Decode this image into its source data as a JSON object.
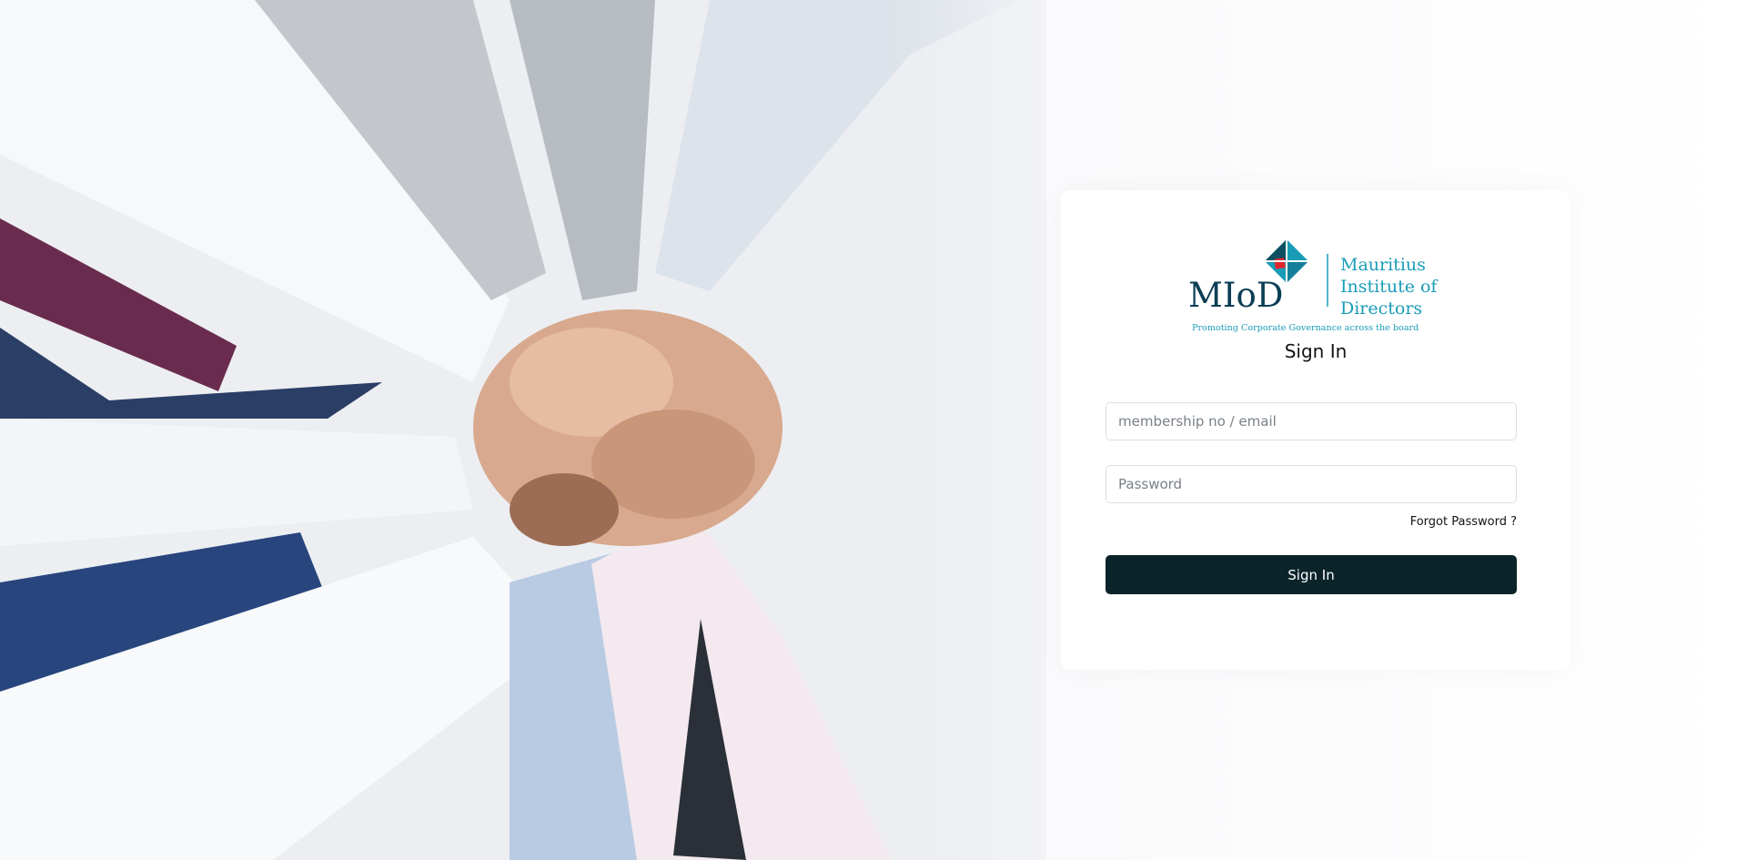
{
  "brand": {
    "logo_mark": "MIoD",
    "logo_name_lines": [
      "Mauritius",
      "Institute of",
      "Directors"
    ],
    "logo_tagline": "Promoting Corporate Governance across the board",
    "primary_color": "#0b242a",
    "accent_color": "#1a9cb8"
  },
  "signin": {
    "title": "Sign In",
    "email_placeholder": "membership no / email",
    "password_placeholder": "Password",
    "forgot_label": "Forgot Password ?",
    "submit_label": "Sign In"
  },
  "icons": {
    "logo": "miod-logo-icon"
  }
}
